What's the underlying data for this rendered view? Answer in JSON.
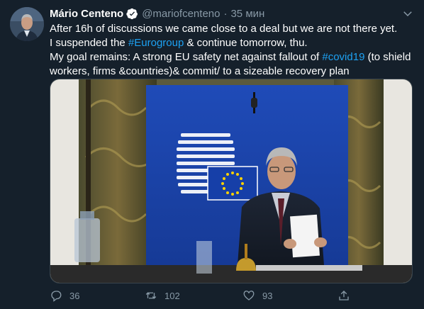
{
  "author": {
    "name": "Mário Centeno",
    "handle": "@mariofcenteno",
    "separator": "·",
    "time": "35 мин"
  },
  "tweet": {
    "line1": "After 16h of discussions we came close to a deal but we are not there yet.",
    "line2_pre": "I suspended the ",
    "line2_tag": "#Eurogroup",
    "line2_post": " & continue tomorrow, thu.",
    "line3_pre": "My goal remains: A strong EU safety net against fallout of ",
    "line3_tag": "#covid19",
    "line3_post": " (to shield",
    "line4": "workers, firms &countries)& commit/ to a sizeable recovery plan"
  },
  "actions": {
    "replies": "36",
    "retweets": "102",
    "likes": "93"
  },
  "colors": {
    "background": "#15202b",
    "link": "#1da1f2",
    "muted": "#8899a6",
    "verified": "#ffffff"
  },
  "icons": [
    "verified-badge-icon",
    "chevron-down-icon",
    "reply-icon",
    "retweet-icon",
    "like-icon",
    "share-icon"
  ]
}
